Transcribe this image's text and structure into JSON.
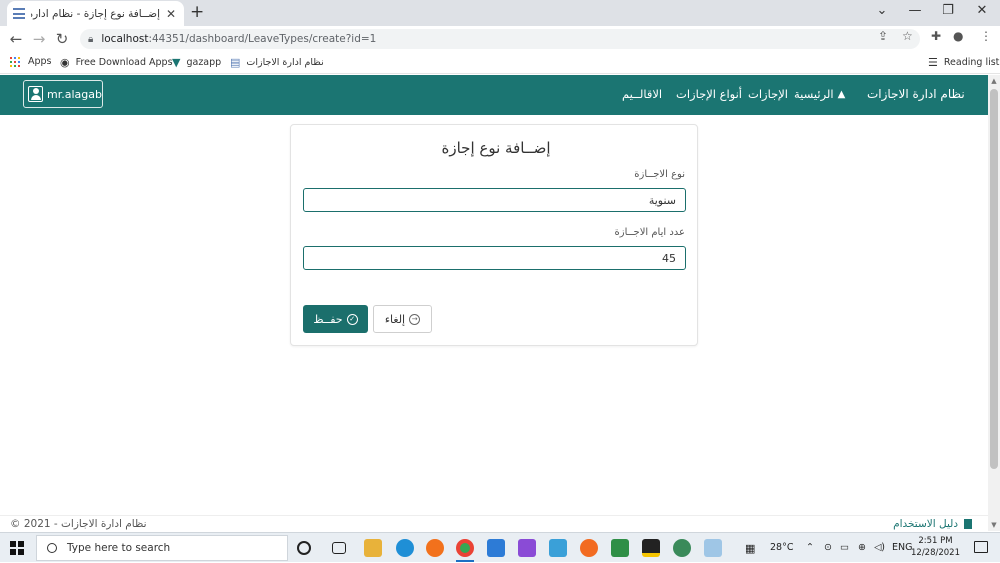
{
  "browser": {
    "tab_title": "إضــافة نوع إجازة - نظام ادارة الاجازات",
    "tab_close": "✕",
    "new_tab": "+",
    "window_controls": {
      "minimize": "—",
      "restore": "❐",
      "close": "✕",
      "tabsearch": "⌄"
    },
    "nav": {
      "back": "←",
      "forward": "→",
      "reload": "↻"
    },
    "url_host": "localhost",
    "url_path": ":44351/dashboard/LeaveTypes/create?id=1",
    "bookmarks": [
      {
        "label": "Apps",
        "icon": "apps-grid-icon"
      },
      {
        "label": "Free Download Apps",
        "icon": "globe-icon"
      },
      {
        "label": "gazapp",
        "icon": "v-logo-icon"
      },
      {
        "label": "نظام ادارة الاجازات",
        "icon": "page-icon"
      }
    ],
    "reading_list": "Reading list"
  },
  "navbar": {
    "brand": "نظام ادارة الاجازات",
    "home": "الرئيسية",
    "leaves": "الإجازات",
    "leave_types": "أنواع الإجازات",
    "regions": "الاقالــيم",
    "user": "mr.alagab"
  },
  "form": {
    "title": "إضــافة نوع إجازة",
    "leave_type_label": "نوع الاجــازة",
    "leave_type_value": "سنوية",
    "days_label": "عدد ايام الاجــازة",
    "days_value": "45",
    "save_label": "حفــظ",
    "cancel_label": "إلغاء"
  },
  "footer": {
    "copyright": "© 2021 - نظام ادارة الاجازات",
    "user_guide": "دليل الاستخدام"
  },
  "taskbar": {
    "search_placeholder": "Type here to search",
    "temperature": "28°C",
    "language": "ENG",
    "time": "2:51 PM",
    "date": "12/28/2021"
  },
  "colors": {
    "primary": "#1b7572",
    "button": "#1b6f6c"
  }
}
